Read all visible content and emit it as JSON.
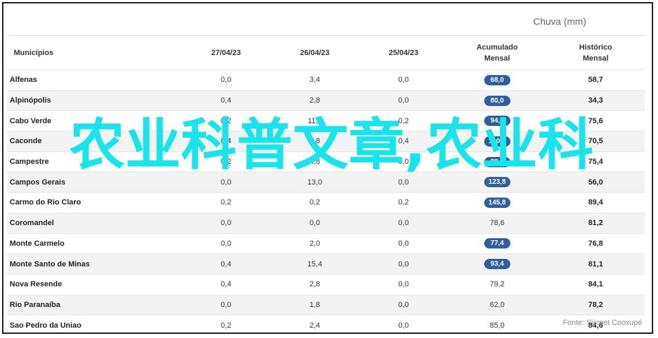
{
  "unit_title": "Chuva (mm)",
  "headers": {
    "municipios": "Municípios",
    "d1": "27/04/23",
    "d2": "26/04/23",
    "d3": "25/04/23",
    "acumulado_1": "Acumulado",
    "acumulado_2": "Mensal",
    "historico_1": "Histórico",
    "historico_2": "Mensal"
  },
  "rows": [
    {
      "name": "Alfenas",
      "d1": "0,0",
      "d2": "3,4",
      "d3": "0,0",
      "acc": "68,0",
      "pill": true,
      "hist": "58,7"
    },
    {
      "name": "Alpinópolis",
      "d1": "0,4",
      "d2": "2,8",
      "d3": "0,0",
      "acc": "80,0",
      "pill": true,
      "hist": "34,3"
    },
    {
      "name": "Cabo Verde",
      "d1": "0,2",
      "d2": "11,4",
      "d3": "0,2",
      "acc": "94,6",
      "pill": true,
      "hist": "75,6"
    },
    {
      "name": "Caconde",
      "d1": "0,4",
      "d2": "7,8",
      "d3": "0,4",
      "acc": "140,8",
      "pill": true,
      "hist": "70,5"
    },
    {
      "name": "Campestre",
      "d1": "0,2",
      "d2": "4,8",
      "d3": "0,0",
      "acc": "88,6",
      "pill": true,
      "hist": "75,4"
    },
    {
      "name": "Campos Gerais",
      "d1": "0,0",
      "d2": "13,0",
      "d3": "0,0",
      "acc": "123,8",
      "pill": true,
      "hist": "56,0"
    },
    {
      "name": "Carmo do Rio Claro",
      "d1": "0,2",
      "d2": "0,2",
      "d3": "0,2",
      "acc": "145,8",
      "pill": true,
      "hist": "89,4"
    },
    {
      "name": "Coromandel",
      "d1": "0,0",
      "d2": "0,0",
      "d3": "0,0",
      "acc": "78,6",
      "pill": false,
      "hist": "81,2"
    },
    {
      "name": "Monte Carmelo",
      "d1": "0,0",
      "d2": "2,0",
      "d3": "0,0",
      "acc": "77,4",
      "pill": true,
      "hist": "76,8"
    },
    {
      "name": "Monte Santo de Minas",
      "d1": "0,4",
      "d2": "15,4",
      "d3": "0,0",
      "acc": "93,4",
      "pill": true,
      "hist": "81,1"
    },
    {
      "name": "Nova Resende",
      "d1": "0,4",
      "d2": "2,8",
      "d3": "0,0",
      "acc": "79,2",
      "pill": false,
      "hist": "84,1"
    },
    {
      "name": "Rio Paranaíba",
      "d1": "0,0",
      "d2": "1,8",
      "d3": "0,0",
      "acc": "62,0",
      "pill": false,
      "hist": "78,2"
    },
    {
      "name": "Sao Pedro da Uniao",
      "d1": "0,2",
      "d2": "2,4",
      "d3": "0,0",
      "acc": "85,0",
      "pill": false,
      "hist": "84,6"
    }
  ],
  "source": "Fonte: Sismet Cooxupé",
  "watermark": "农业科普文章,农业科",
  "colors": {
    "pill": "#2f5f9e",
    "watermark": "#18e4ec"
  }
}
